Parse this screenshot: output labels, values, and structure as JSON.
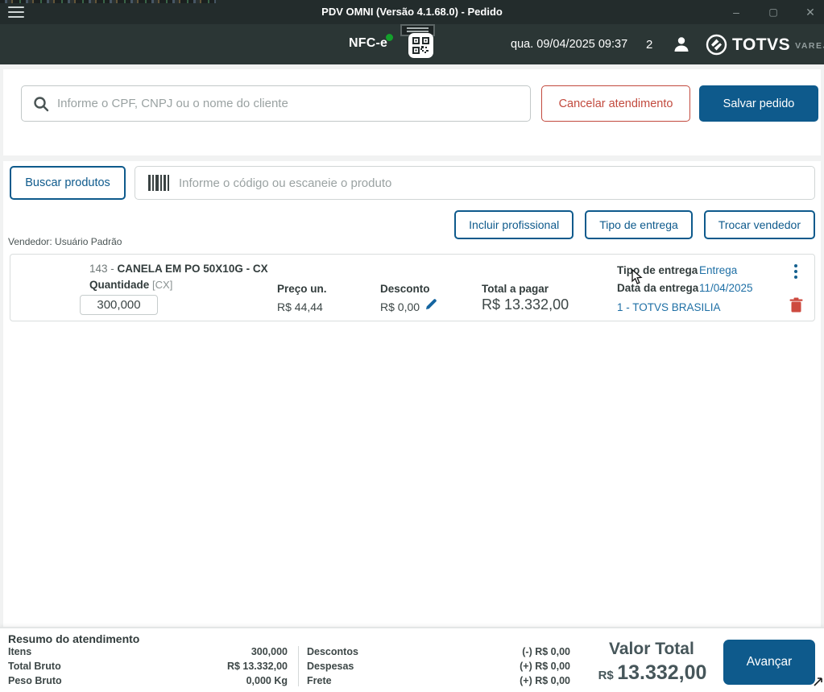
{
  "window": {
    "title": "PDV OMNI (Versão 4.1.68.0) - Pedido",
    "minimize": "–",
    "maximize": "▢",
    "close": "✕"
  },
  "header": {
    "nfce_label": "NFC-e",
    "datetime": "qua. 09/04/2025 09:37",
    "counter": "2",
    "brand_name": "TOTVS",
    "brand_suffix": "VAREJO"
  },
  "client_section": {
    "search_placeholder": "Informe o CPF, CNPJ ou o nome do cliente",
    "cancel_button": "Cancelar atendimento",
    "save_button": "Salvar pedido"
  },
  "product_section": {
    "search_products_button": "Buscar produtos",
    "barcode_placeholder": "Informe o código ou escaneie o produto",
    "actions": [
      {
        "label": "Incluir profissional"
      },
      {
        "label": "Tipo de entrega"
      },
      {
        "label": "Trocar vendedor"
      }
    ],
    "seller_label": "Vendedor: Usuário Padrão"
  },
  "product_row": {
    "code": "143 - ",
    "name": "CANELA EM PO 50X10G - CX",
    "quantity_label": "Quantidade",
    "unit_tag": "[CX]",
    "quantity_value": "300,000",
    "unit_price_label": "Preço un.",
    "unit_price_value": "R$ 44,44",
    "discount_label": "Desconto",
    "discount_value": "R$ 0,00",
    "total_label": "Total a pagar",
    "total_value": "R$ 13.332,00",
    "delivery_type_label": "Tipo de entrega",
    "delivery_type_value": "Entrega",
    "delivery_date_label": "Data da entrega",
    "delivery_date_value": "11/04/2025",
    "store_link": "1 - TOTVS BRASILIA"
  },
  "summary": {
    "title": "Resumo do atendimento",
    "left_rows": [
      {
        "label": "Itens",
        "value": "300,000"
      },
      {
        "label": "Total Bruto",
        "value": "R$ 13.332,00"
      },
      {
        "label": "Peso Bruto",
        "value": "0,000 Kg"
      }
    ],
    "mid_rows": [
      {
        "label": "Descontos",
        "value": "(-) R$ 0,00"
      },
      {
        "label": "Despesas",
        "value": "(+) R$ 0,00"
      },
      {
        "label": "Frete",
        "value": "(+) R$ 0,00"
      }
    ],
    "total_label": "Valor Total",
    "total_currency": "R$",
    "total_value": "13.332,00",
    "advance_button": "Avançar"
  },
  "colors": {
    "titlebar": "#232c2c",
    "header": "#2b3635",
    "primary_blue": "#0e5a8c",
    "link_blue": "#1e6fa5",
    "danger_red": "#c24a3e",
    "trash_red": "#cd4a3f",
    "status_green": "#14a02c",
    "page_bg": "#f1f2f2"
  }
}
